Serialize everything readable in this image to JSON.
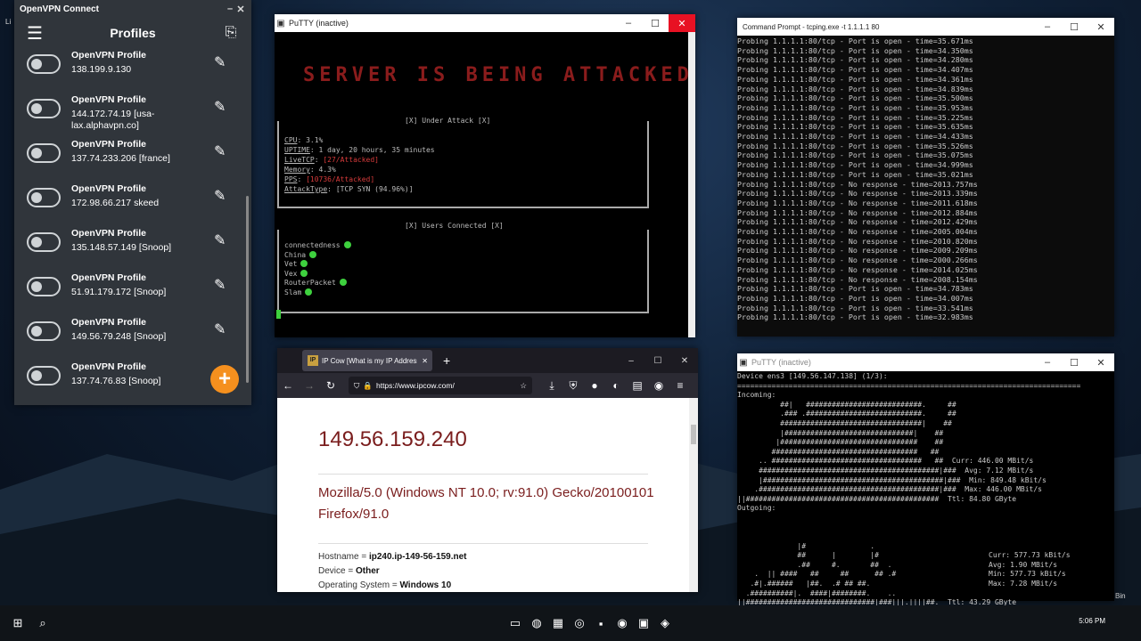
{
  "desktop": {
    "left_label": "Li",
    "right_label": "Bin"
  },
  "openvpn": {
    "window_title": "OpenVPN Connect",
    "header_title": "Profiles",
    "profiles": [
      {
        "name": "OpenVPN Profile",
        "addr": "138.199.9.130"
      },
      {
        "name": "OpenVPN Profile",
        "addr": "144.172.74.19 [usa-lax.alphavpn.co]"
      },
      {
        "name": "OpenVPN Profile",
        "addr": "137.74.233.206 [france]"
      },
      {
        "name": "OpenVPN Profile",
        "addr": "172.98.66.217 skeed"
      },
      {
        "name": "OpenVPN Profile",
        "addr": "135.148.57.149 [Snoop]"
      },
      {
        "name": "OpenVPN Profile",
        "addr": "51.91.179.172 [Snoop]"
      },
      {
        "name": "OpenVPN Profile",
        "addr": "149.56.79.248 [Snoop]"
      },
      {
        "name": "OpenVPN Profile",
        "addr": "137.74.76.83 [Snoop]"
      }
    ],
    "accent": "#f5901e"
  },
  "putty1": {
    "window_title": "PuTTY (inactive)",
    "banner": "SERVER IS BEING ATTACKED",
    "status_header": "[X] Under Attack [X]",
    "cpu_label": "CPU",
    "cpu_val": "3.1%",
    "uptime_label": "UPTIME",
    "uptime_val": "1 day, 20 hours, 35 minutes",
    "livetcp_label": "LiveTCP",
    "livetcp_val": "[27/Attacked]",
    "memory_label": "Memory",
    "memory_val": "4.3%",
    "pps_label": "PPS",
    "pps_val": "[10736/Attacked]",
    "attacktype_label": "AttackType",
    "attacktype_val": "[TCP SYN (94.96%)]",
    "users_header": "[X] Users Connected [X]",
    "users": [
      "connectedness",
      "China",
      "Vet",
      "Vex",
      "RouterPacket",
      "Slam"
    ]
  },
  "cmd": {
    "window_title": "Command Prompt - tcping.exe -t 1.1.1.1 80",
    "lines": [
      "Probing 1.1.1.1:80/tcp - Port is open - time=35.671ms",
      "Probing 1.1.1.1:80/tcp - Port is open - time=34.350ms",
      "Probing 1.1.1.1:80/tcp - Port is open - time=34.280ms",
      "Probing 1.1.1.1:80/tcp - Port is open - time=34.407ms",
      "Probing 1.1.1.1:80/tcp - Port is open - time=34.361ms",
      "Probing 1.1.1.1:80/tcp - Port is open - time=34.839ms",
      "Probing 1.1.1.1:80/tcp - Port is open - time=35.500ms",
      "Probing 1.1.1.1:80/tcp - Port is open - time=35.953ms",
      "Probing 1.1.1.1:80/tcp - Port is open - time=35.225ms",
      "Probing 1.1.1.1:80/tcp - Port is open - time=35.635ms",
      "Probing 1.1.1.1:80/tcp - Port is open - time=34.433ms",
      "Probing 1.1.1.1:80/tcp - Port is open - time=35.526ms",
      "Probing 1.1.1.1:80/tcp - Port is open - time=35.075ms",
      "Probing 1.1.1.1:80/tcp - Port is open - time=34.999ms",
      "Probing 1.1.1.1:80/tcp - Port is open - time=35.021ms",
      "Probing 1.1.1.1:80/tcp - No response - time=2013.757ms",
      "Probing 1.1.1.1:80/tcp - No response - time=2013.339ms",
      "Probing 1.1.1.1:80/tcp - No response - time=2011.618ms",
      "Probing 1.1.1.1:80/tcp - No response - time=2012.884ms",
      "Probing 1.1.1.1:80/tcp - No response - time=2012.429ms",
      "Probing 1.1.1.1:80/tcp - No response - time=2005.004ms",
      "Probing 1.1.1.1:80/tcp - No response - time=2010.820ms",
      "Probing 1.1.1.1:80/tcp - No response - time=2009.209ms",
      "Probing 1.1.1.1:80/tcp - No response - time=2000.266ms",
      "Probing 1.1.1.1:80/tcp - No response - time=2014.025ms",
      "Probing 1.1.1.1:80/tcp - No response - time=2008.154ms",
      "Probing 1.1.1.1:80/tcp - Port is open - time=34.783ms",
      "Probing 1.1.1.1:80/tcp - Port is open - time=34.007ms",
      "Probing 1.1.1.1:80/tcp - Port is open - time=33.541ms",
      "Probing 1.1.1.1:80/tcp - Port is open - time=32.983ms"
    ]
  },
  "firefox": {
    "tab_title": "IP Cow [What is my IP Address?]",
    "favicon": "IP",
    "url": "https://www.ipcow.com/",
    "ip": "149.56.159.240",
    "useragent": "Mozilla/5.0 (Windows NT 10.0; rv:91.0) Gecko/20100101 Firefox/91.0",
    "hostname_label": "Hostname",
    "hostname_val": "ip240.ip-149-56-159.net",
    "device_label": "Device",
    "device_val": "Other",
    "os_label": "Operating System",
    "os_val": "Windows 10"
  },
  "putty2": {
    "window_title": "PuTTY (inactive)",
    "lines": [
      "Device ens3 [149.56.147.138] (1/3):",
      "================================================================================",
      "Incoming:",
      "          ##|   ###########################.     ##",
      "          .### .###########################.     ##",
      "          #################################|    ##",
      "          |##############################|    ##",
      "         |################################    ##",
      "        ##################################   ##",
      "     .. ###################################   ##  Curr: 446.00 MBit/s",
      "     ##########################################|###  Avg: 7.12 MBit/s",
      "     |##########################################|###  Min: 849.48 kBit/s",
      "    .##########################################|###  Max: 446.00 MBit/s",
      "||#############################################  Ttl: 84.80 GByte",
      "Outgoing:",
      "",
      "",
      "",
      "              |#               .",
      "              ##      |        |#",
      "              .##     #.       ##  .",
      "    .  || ####   ##     ##      ## .#",
      "   .#|.######   |##.  .# ## ##.",
      "  .##########|.  ####|########.    ..",
      "||##############################|###|||.||||##.  Ttl: 43.29 GByte"
    ],
    "stats_out": [
      "Curr: 577.73 kBit/s",
      "Avg: 1.90 MBit/s",
      "Min: 577.73 kBit/s",
      "Max: 7.28 MBit/s"
    ]
  },
  "taskbar": {
    "clock": "5:06 PM"
  }
}
